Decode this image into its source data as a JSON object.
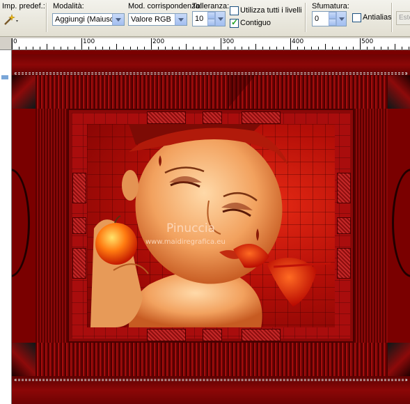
{
  "toolbar": {
    "preset_label": "Imp. predef.:",
    "mode_label": "Modalità:",
    "mode_value": "Aggiungi (Maiusc)",
    "match_label": "Mod. corrispondenza:",
    "match_value": "Valore RGB",
    "tolerance_label": "Tolleranza:",
    "tolerance_value": "10",
    "use_all_layers_label": "Utilizza tutti i livelli",
    "use_all_layers_checked": false,
    "contiguous_label": "Contiguo",
    "contiguous_checked": true,
    "feather_label": "Sfumatura:",
    "feather_value": "0",
    "antialias_label": "Antialias",
    "antialias_checked": false,
    "extra_button_label": "Este"
  },
  "ruler": {
    "ticks": [
      "0",
      "100",
      "200",
      "300",
      "400",
      "500"
    ]
  },
  "watermark": {
    "line1": "Pinuccia",
    "line2": "www.maidiregrafica.eu"
  },
  "colors": {
    "canvas_red": "#a90d0d",
    "dark_red": "#5a0000",
    "accent_blue": "#7aa6d8"
  },
  "icons": {
    "preset": "magic-wand-icon",
    "dropdown": "chevron-down-icon"
  }
}
